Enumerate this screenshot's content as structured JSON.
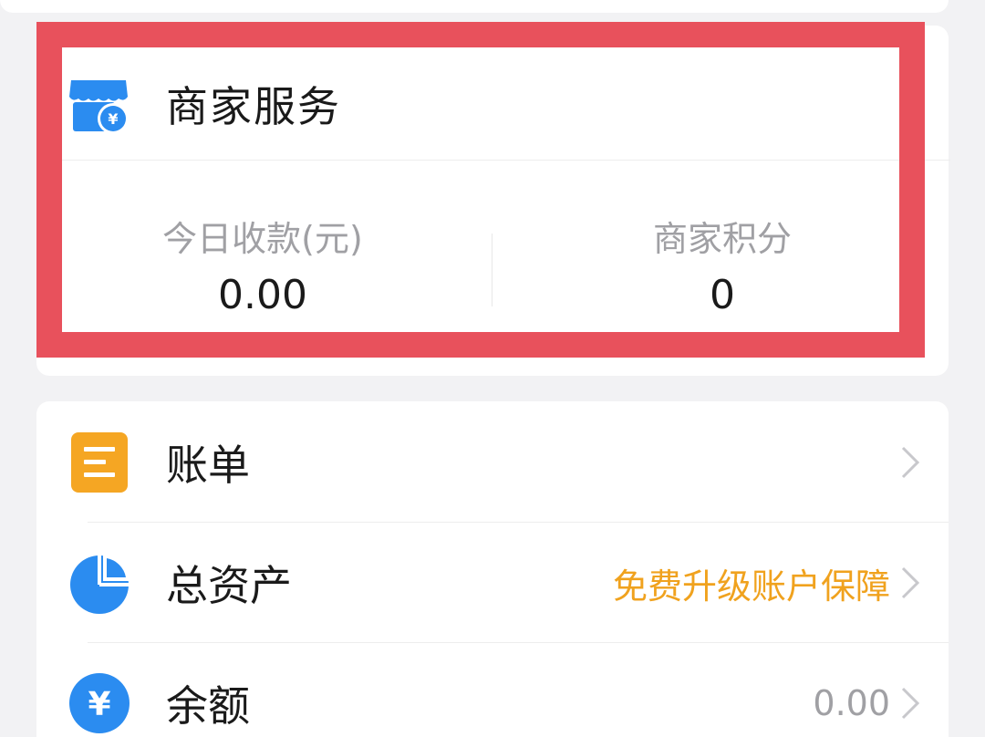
{
  "merchant": {
    "title": "商家服务",
    "icon": "store-yuan-icon",
    "stats": [
      {
        "label": "今日收款(元)",
        "value": "0.00"
      },
      {
        "label": "商家积分",
        "value": "0"
      }
    ],
    "highlight_color": "#e8515c"
  },
  "menu": {
    "items": [
      {
        "label": "账单",
        "icon": "bill-list-icon",
        "extra": ""
      },
      {
        "label": "总资产",
        "icon": "pie-chart-icon",
        "extra": "免费升级账户保障"
      },
      {
        "label": "余额",
        "icon": "yuan-coin-icon",
        "extra": "0.00"
      }
    ]
  },
  "colors": {
    "accent_blue": "#2b8cf0",
    "accent_orange": "#f5a623",
    "promo_text": "#f0a21e"
  }
}
